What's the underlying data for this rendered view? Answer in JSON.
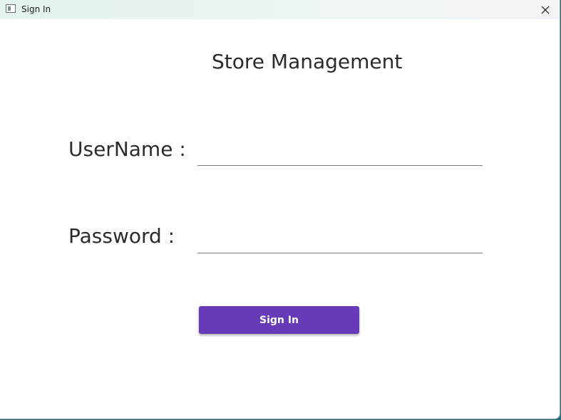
{
  "window": {
    "title": "Sign In",
    "icon": "app-window-icon",
    "close_icon": "close-icon"
  },
  "main": {
    "heading": "Store Management",
    "username_label": "UserName :",
    "username_value": "",
    "password_label": "Password :",
    "password_value": "",
    "signin_label": "Sign In"
  },
  "colors": {
    "accent": "#673ab7",
    "background": "#ffffff",
    "text": "#2b2b2b"
  }
}
